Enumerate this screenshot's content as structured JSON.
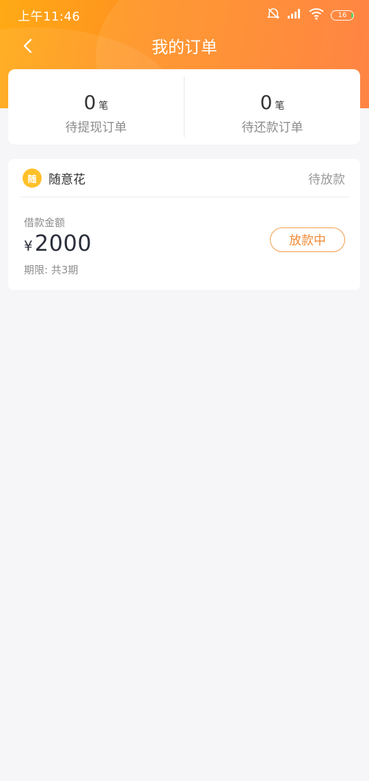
{
  "status_bar": {
    "time": "上午11:46",
    "battery": "16"
  },
  "nav": {
    "title": "我的订单"
  },
  "summary": {
    "unit": "笔",
    "items": [
      {
        "count": "0",
        "label": "待提现订单"
      },
      {
        "count": "0",
        "label": "待还款订单"
      }
    ]
  },
  "order": {
    "logo_text": "随",
    "product_name": "随意花",
    "status": "待放款",
    "amount_label": "借款金额",
    "currency": "¥",
    "amount": "2000",
    "term": "期限: 共3期",
    "button_label": "放款中"
  },
  "colors": {
    "header_start": "#ffaa14",
    "header_end": "#ff7a34",
    "accent": "#f08a35",
    "background": "#f6f6f8"
  }
}
